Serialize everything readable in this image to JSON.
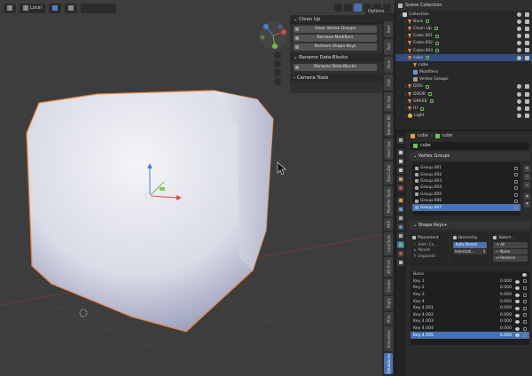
{
  "viewport_header": {
    "orientation_label": "Local",
    "view_mode": "Solid"
  },
  "npanel": {
    "options_label": "Options",
    "sections": [
      {
        "title": "Clean Up",
        "buttons": [
          "Clear Vertex Groups",
          "Remove Modifiers",
          "Remove Shape Keys"
        ]
      },
      {
        "title": "Rename Data-Blocks",
        "buttons": [
          "Rename Data-Blocks"
        ]
      },
      {
        "title": "Camera Tools",
        "buttons": []
      }
    ]
  },
  "side_tabs": [
    "Item",
    "Tool",
    "View",
    "Edit",
    "Kit Ops",
    "Blender Kit",
    "Hard Ops",
    "BoxCutter",
    "Modifier Tools",
    "ARP",
    "LoopTools",
    "3D-Print",
    "Create",
    "Rigify",
    "Misc",
    "Animation",
    "Datablocks"
  ],
  "outliner": {
    "title": "Scene Collection",
    "rows": [
      {
        "label": "Collection",
        "depth": 0,
        "icon": "collection-icon"
      },
      {
        "label": "Back",
        "depth": 1,
        "icon": "mesh-icon"
      },
      {
        "label": "Clean Up",
        "depth": 1,
        "icon": "mesh-icon"
      },
      {
        "label": "Cube.001",
        "depth": 1,
        "icon": "mesh-icon"
      },
      {
        "label": "Cube.002",
        "depth": 1,
        "icon": "mesh-icon"
      },
      {
        "label": "Cube.003",
        "depth": 1,
        "icon": "mesh-icon"
      },
      {
        "label": "cube",
        "depth": 1,
        "icon": "mesh-icon",
        "selected": true
      },
      {
        "label": "cube",
        "depth": 2,
        "icon": "mesh-icon"
      },
      {
        "label": "Modifiers",
        "depth": 2,
        "icon": "modifier-icon"
      },
      {
        "label": "Vertex Groups",
        "depth": 2,
        "icon": "vertex-group-icon"
      },
      {
        "label": "DOG",
        "depth": 1,
        "icon": "mesh-icon"
      },
      {
        "label": "DOOR",
        "depth": 1,
        "icon": "mesh-icon"
      },
      {
        "label": "GRASS",
        "depth": 1,
        "icon": "mesh-icon"
      },
      {
        "label": "HI",
        "depth": 1,
        "icon": "mesh-icon"
      },
      {
        "label": "Light",
        "depth": 1,
        "icon": "light-icon"
      }
    ]
  },
  "properties": {
    "breadcrumb": [
      "cube",
      "cube"
    ],
    "data_name": "cube",
    "vertex_groups_title": "Vertex Groups",
    "vertex_groups": [
      "Group.001",
      "Group.002",
      "Group.003",
      "Group.004",
      "Group.005",
      "Group.006",
      "Group.007"
    ],
    "selected_vertex_group": "Group.007",
    "shape_keys_title": "Shape Keys+",
    "placement": {
      "title": "Placement",
      "rows": [
        "Add / Co...",
        "Parent",
        "Unparent"
      ]
    },
    "hierarchy": {
      "title": "Hierarchy",
      "auto_parent": "Auto Parent",
      "indent_label": "Indentati...",
      "indent_value": "3"
    },
    "selection": {
      "title": "Select...",
      "buttons": [
        "All",
        "None",
        "Reverse"
      ]
    },
    "keys_header": "Basis",
    "keys": [
      {
        "name": "Key 1",
        "value": "0.000"
      },
      {
        "name": "Key 2",
        "value": "0.000"
      },
      {
        "name": "Key 3",
        "value": "0.000"
      },
      {
        "name": "Key 4",
        "value": "0.000"
      },
      {
        "name": "Key 4.001",
        "value": "0.000"
      },
      {
        "name": "Key 4.002",
        "value": "0.000"
      },
      {
        "name": "Key 4.003",
        "value": "0.000"
      },
      {
        "name": "Key 4.004",
        "value": "0.000"
      },
      {
        "name": "Key 4.005",
        "value": "0.000"
      }
    ],
    "selected_key": "Key 4.005"
  },
  "colors": {
    "selection_outline": "#e8823a",
    "accent": "#4772b3",
    "viewport_bg": "#3d3d3d"
  }
}
